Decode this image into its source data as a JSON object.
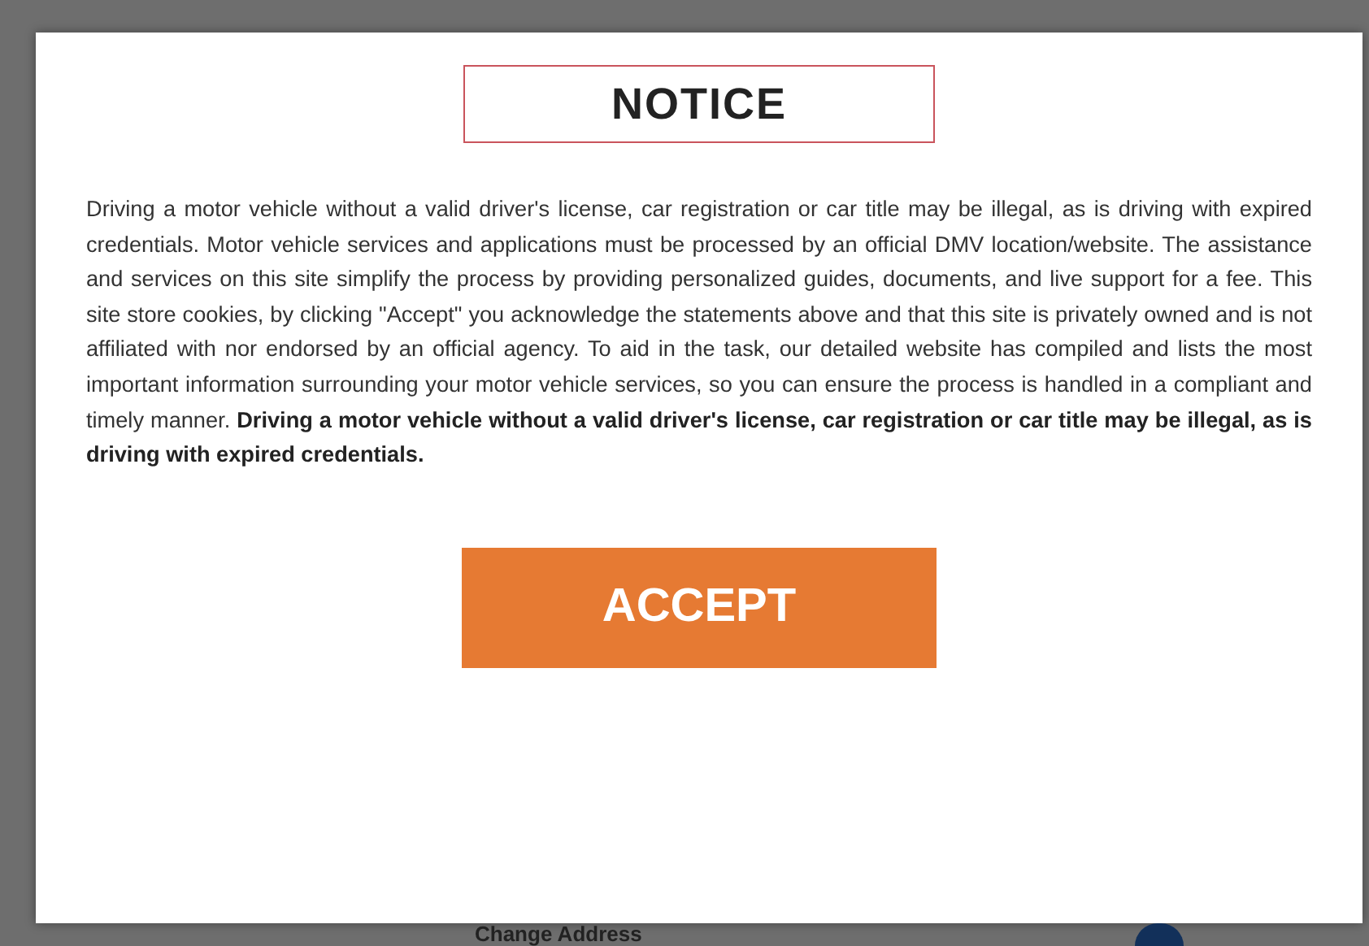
{
  "background": {
    "link": "Change Address"
  },
  "modal": {
    "title": "NOTICE",
    "body": "Driving a motor vehicle without a valid driver's license, car registration or car title may be illegal, as is driving with expired credentials. Motor vehicle services and applications must be processed by an official DMV location/website. The assistance and services on this site simplify the process by providing personalized guides, documents, and live support for a fee. This site store cookies, by clicking \"Accept\" you acknowledge the statements above and that this site is privately owned and is not affiliated with nor endorsed by an official agency. To aid in the task, our detailed website has compiled and lists the most important information surrounding your motor vehicle services, so you can ensure the process is handled in a compliant and timely manner. **Driving a motor vehicle without a valid driver's license, car registration or car title may be illegal, as is driving with expired credentials.**",
    "button": "ACCEPT"
  }
}
